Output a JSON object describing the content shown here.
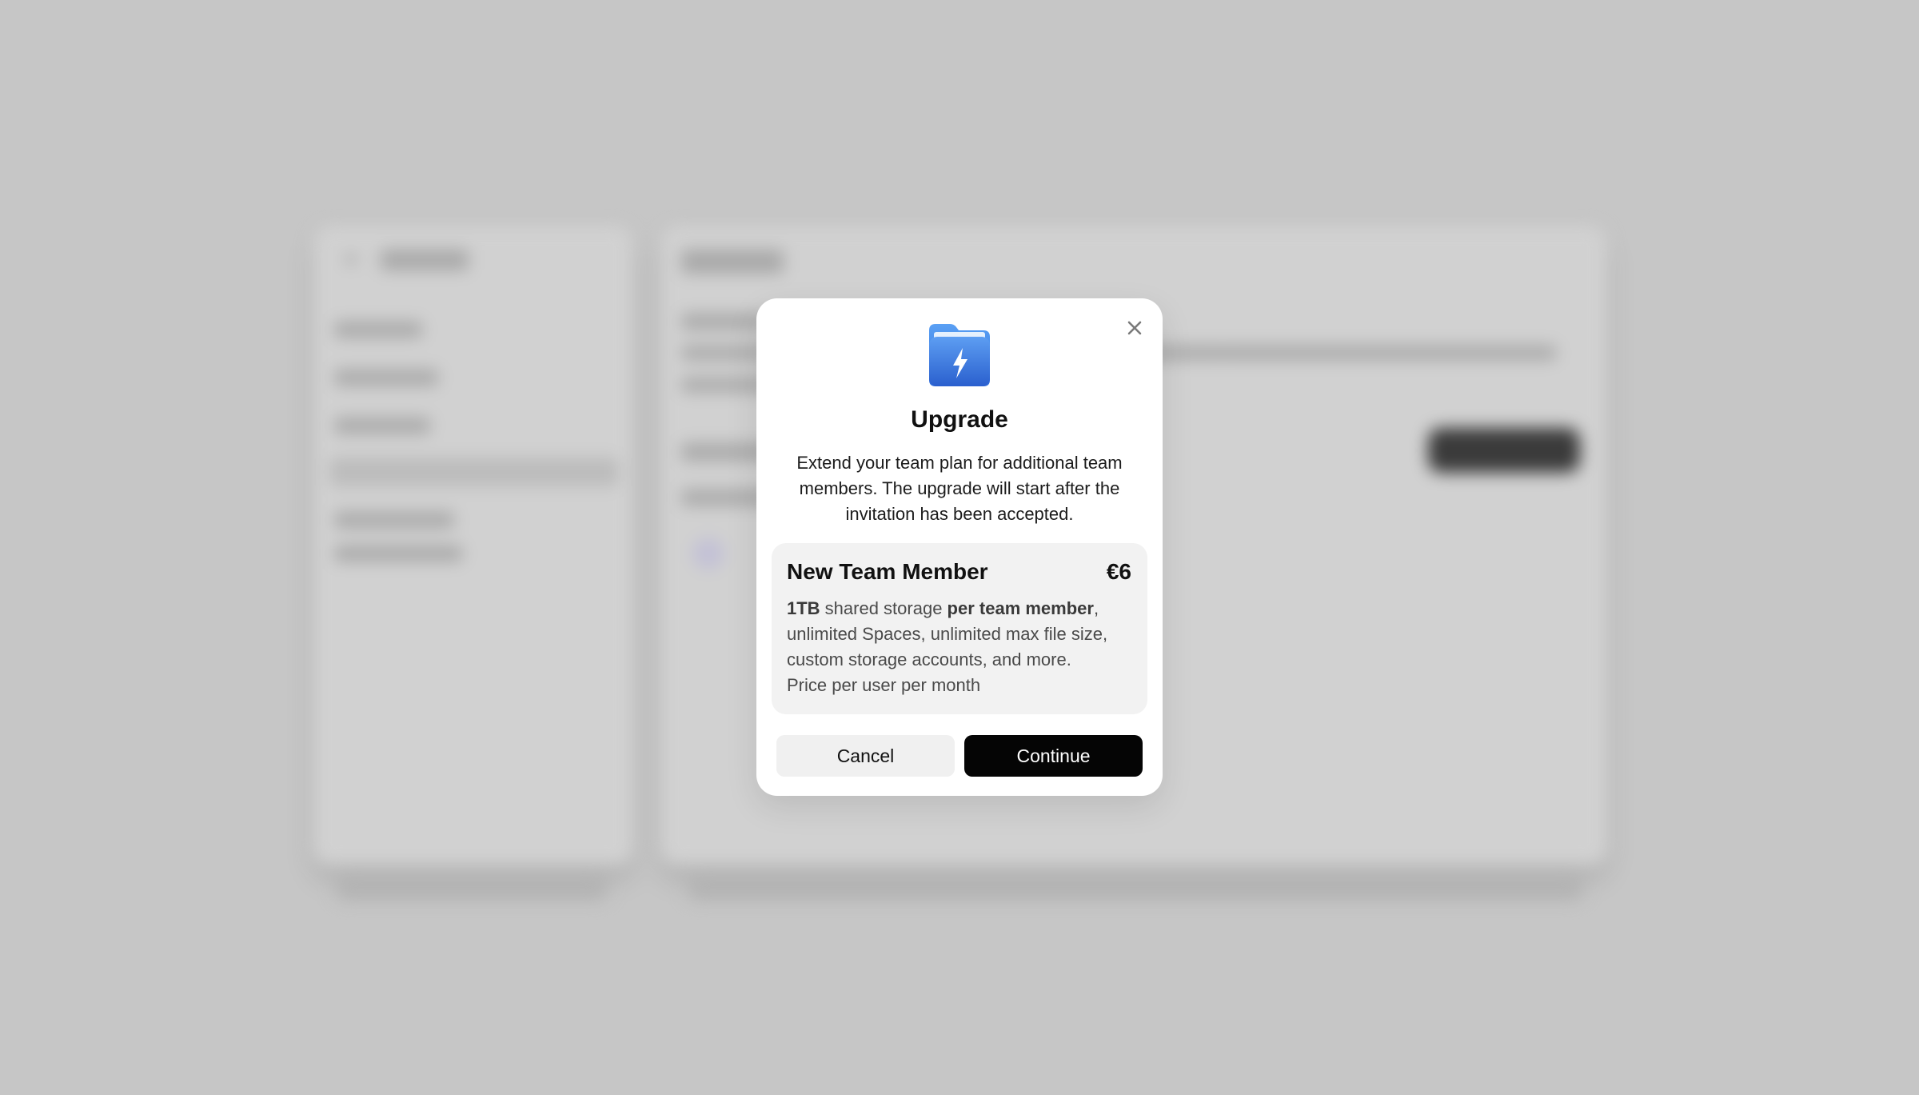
{
  "modal": {
    "close_icon": "close-icon",
    "app_icon": "lightning-folder-icon",
    "title": "Upgrade",
    "description": "Extend your team plan for additional team members. The upgrade will start after the invitation has been accepted.",
    "plan": {
      "name": "New Team Member",
      "price": "€6",
      "storage_amount": "1TB",
      "storage_text": " shared storage ",
      "storage_scope": "per team member",
      "features_rest": ", unlimited Spaces, unlimited max file size, custom storage accounts, and more.",
      "price_note": "Price per user per month"
    },
    "cancel_label": "Cancel",
    "continue_label": "Continue"
  },
  "colors": {
    "backdrop": "#c6c6c6",
    "icon_blue": "#2d6fe0",
    "primary_button": "#050505",
    "secondary_button": "#f0f0f0",
    "card_background": "#f2f2f2"
  }
}
